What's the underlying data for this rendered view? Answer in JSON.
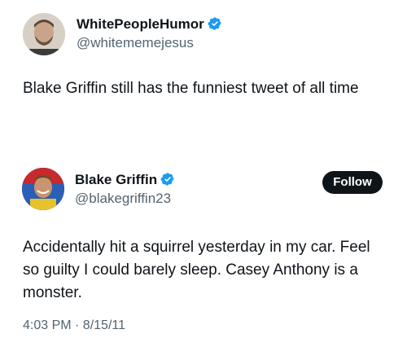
{
  "outer_tweet": {
    "display_name": "WhitePeopleHumor",
    "handle": "@whitememejesus",
    "verified": true,
    "text": "Blake Griffin still has the funniest tweet of all time"
  },
  "quoted_tweet": {
    "display_name": "Blake Griffin",
    "handle": "@blakegriffin23",
    "verified": true,
    "follow_label": "Follow",
    "text": "Accidentally hit a squirrel yesterday in my car. Feel so guilty I could barely sleep. Casey Anthony is a monster.",
    "timestamp": "4:03 PM · 8/15/11"
  },
  "colors": {
    "verified_blue": "#1d9bf0",
    "text_primary": "#0f1419",
    "text_secondary": "#536471",
    "follow_bg": "#0f1419"
  },
  "icons": {
    "verified": "verified-badge-icon"
  }
}
